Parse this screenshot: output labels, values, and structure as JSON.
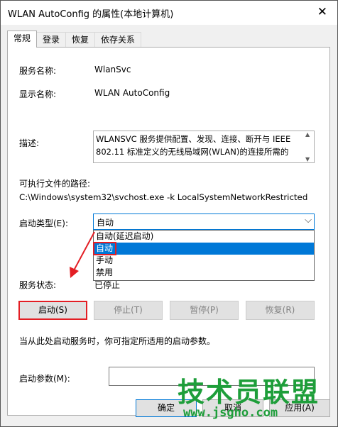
{
  "window": {
    "title": "WLAN AutoConfig 的属性(本地计算机)",
    "close_glyph": "✕"
  },
  "tabs": [
    {
      "label": "常规"
    },
    {
      "label": "登录"
    },
    {
      "label": "恢复"
    },
    {
      "label": "依存关系"
    }
  ],
  "general": {
    "service_name_label": "服务名称:",
    "service_name_value": "WlanSvc",
    "display_name_label": "显示名称:",
    "display_name_value": "WLAN AutoConfig",
    "description_label": "描述:",
    "description_value": "WLANSVC 服务提供配置、发现、连接、断开与 IEEE 802.11 标准定义的无线局域网(WLAN)的连接所需的",
    "exe_path_label": "可执行文件的路径:",
    "exe_path_value": "C:\\Windows\\system32\\svchost.exe -k LocalSystemNetworkRestricted",
    "startup_type_label": "启动类型(E):",
    "startup_type_value": "自动",
    "startup_type_options": [
      "自动(延迟启动)",
      "自动",
      "手动",
      "禁用"
    ],
    "startup_type_selected_index": 1,
    "status_label": "服务状态:",
    "status_value": "已停止",
    "buttons": {
      "start": "启动(S)",
      "stop": "停止(T)",
      "pause": "暂停(P)",
      "resume": "恢复(R)"
    },
    "hint": "当从此处启动服务时，你可指定所适用的启动参数。",
    "start_params_label": "启动参数(M):",
    "start_params_value": ""
  },
  "footer": {
    "ok": "确定",
    "cancel": "取消",
    "apply": "应用(A)"
  },
  "watermark": {
    "text": "技术员联盟",
    "url": "www.jsgho.com"
  },
  "colors": {
    "accent": "#0078d7",
    "annotation_red": "#e31e24",
    "watermark_green": "#1e9e3a"
  }
}
